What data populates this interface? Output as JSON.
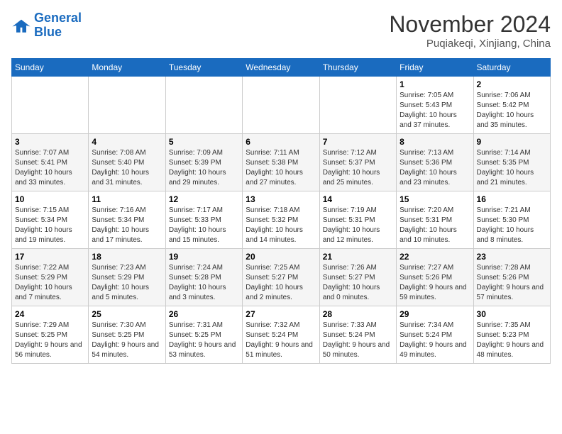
{
  "logo": {
    "line1": "General",
    "line2": "Blue"
  },
  "title": "November 2024",
  "location": "Puqiakeqi, Xinjiang, China",
  "days_header": [
    "Sunday",
    "Monday",
    "Tuesday",
    "Wednesday",
    "Thursday",
    "Friday",
    "Saturday"
  ],
  "weeks": [
    [
      {
        "num": "",
        "info": ""
      },
      {
        "num": "",
        "info": ""
      },
      {
        "num": "",
        "info": ""
      },
      {
        "num": "",
        "info": ""
      },
      {
        "num": "",
        "info": ""
      },
      {
        "num": "1",
        "info": "Sunrise: 7:05 AM\nSunset: 5:43 PM\nDaylight: 10 hours and 37 minutes."
      },
      {
        "num": "2",
        "info": "Sunrise: 7:06 AM\nSunset: 5:42 PM\nDaylight: 10 hours and 35 minutes."
      }
    ],
    [
      {
        "num": "3",
        "info": "Sunrise: 7:07 AM\nSunset: 5:41 PM\nDaylight: 10 hours and 33 minutes."
      },
      {
        "num": "4",
        "info": "Sunrise: 7:08 AM\nSunset: 5:40 PM\nDaylight: 10 hours and 31 minutes."
      },
      {
        "num": "5",
        "info": "Sunrise: 7:09 AM\nSunset: 5:39 PM\nDaylight: 10 hours and 29 minutes."
      },
      {
        "num": "6",
        "info": "Sunrise: 7:11 AM\nSunset: 5:38 PM\nDaylight: 10 hours and 27 minutes."
      },
      {
        "num": "7",
        "info": "Sunrise: 7:12 AM\nSunset: 5:37 PM\nDaylight: 10 hours and 25 minutes."
      },
      {
        "num": "8",
        "info": "Sunrise: 7:13 AM\nSunset: 5:36 PM\nDaylight: 10 hours and 23 minutes."
      },
      {
        "num": "9",
        "info": "Sunrise: 7:14 AM\nSunset: 5:35 PM\nDaylight: 10 hours and 21 minutes."
      }
    ],
    [
      {
        "num": "10",
        "info": "Sunrise: 7:15 AM\nSunset: 5:34 PM\nDaylight: 10 hours and 19 minutes."
      },
      {
        "num": "11",
        "info": "Sunrise: 7:16 AM\nSunset: 5:34 PM\nDaylight: 10 hours and 17 minutes."
      },
      {
        "num": "12",
        "info": "Sunrise: 7:17 AM\nSunset: 5:33 PM\nDaylight: 10 hours and 15 minutes."
      },
      {
        "num": "13",
        "info": "Sunrise: 7:18 AM\nSunset: 5:32 PM\nDaylight: 10 hours and 14 minutes."
      },
      {
        "num": "14",
        "info": "Sunrise: 7:19 AM\nSunset: 5:31 PM\nDaylight: 10 hours and 12 minutes."
      },
      {
        "num": "15",
        "info": "Sunrise: 7:20 AM\nSunset: 5:31 PM\nDaylight: 10 hours and 10 minutes."
      },
      {
        "num": "16",
        "info": "Sunrise: 7:21 AM\nSunset: 5:30 PM\nDaylight: 10 hours and 8 minutes."
      }
    ],
    [
      {
        "num": "17",
        "info": "Sunrise: 7:22 AM\nSunset: 5:29 PM\nDaylight: 10 hours and 7 minutes."
      },
      {
        "num": "18",
        "info": "Sunrise: 7:23 AM\nSunset: 5:29 PM\nDaylight: 10 hours and 5 minutes."
      },
      {
        "num": "19",
        "info": "Sunrise: 7:24 AM\nSunset: 5:28 PM\nDaylight: 10 hours and 3 minutes."
      },
      {
        "num": "20",
        "info": "Sunrise: 7:25 AM\nSunset: 5:27 PM\nDaylight: 10 hours and 2 minutes."
      },
      {
        "num": "21",
        "info": "Sunrise: 7:26 AM\nSunset: 5:27 PM\nDaylight: 10 hours and 0 minutes."
      },
      {
        "num": "22",
        "info": "Sunrise: 7:27 AM\nSunset: 5:26 PM\nDaylight: 9 hours and 59 minutes."
      },
      {
        "num": "23",
        "info": "Sunrise: 7:28 AM\nSunset: 5:26 PM\nDaylight: 9 hours and 57 minutes."
      }
    ],
    [
      {
        "num": "24",
        "info": "Sunrise: 7:29 AM\nSunset: 5:25 PM\nDaylight: 9 hours and 56 minutes."
      },
      {
        "num": "25",
        "info": "Sunrise: 7:30 AM\nSunset: 5:25 PM\nDaylight: 9 hours and 54 minutes."
      },
      {
        "num": "26",
        "info": "Sunrise: 7:31 AM\nSunset: 5:25 PM\nDaylight: 9 hours and 53 minutes."
      },
      {
        "num": "27",
        "info": "Sunrise: 7:32 AM\nSunset: 5:24 PM\nDaylight: 9 hours and 51 minutes."
      },
      {
        "num": "28",
        "info": "Sunrise: 7:33 AM\nSunset: 5:24 PM\nDaylight: 9 hours and 50 minutes."
      },
      {
        "num": "29",
        "info": "Sunrise: 7:34 AM\nSunset: 5:24 PM\nDaylight: 9 hours and 49 minutes."
      },
      {
        "num": "30",
        "info": "Sunrise: 7:35 AM\nSunset: 5:23 PM\nDaylight: 9 hours and 48 minutes."
      }
    ]
  ]
}
